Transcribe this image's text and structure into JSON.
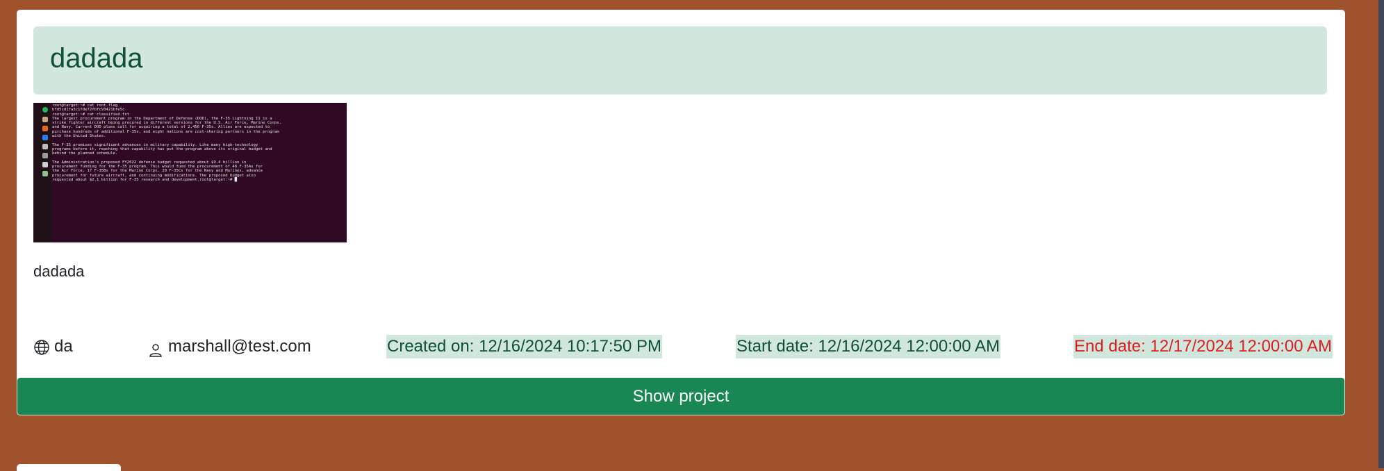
{
  "project": {
    "title": "dadada",
    "description": "dadada",
    "language": "da",
    "owner": "marshall@test.com",
    "created": "Created on: 12/16/2024 10:17:50 PM",
    "start": "Start date: 12/16/2024 12:00:00 AM",
    "end": "End date: 12/17/2024 12:00:00 AM",
    "button_label": "Show project"
  },
  "thumbnail": {
    "terminal_text": "root@target:~# cat root.flag\nbfd5cd1fa3c1fde72fbfc93421bfe5c\nroot@target:~# cat classified.txt\nThe largest procurement program in the Department of Defense (DOD), the F-35 Lightning II is a\nstrike fighter aircraft being procured in different versions for the U.S. Air Force, Marine Corps,\nand Navy. Current DOD plans call for acquiring a total of 2,456 F-35s. Allies are expected to\npurchase hundreds of additional F-35s, and eight nations are cost-sharing partners in the program\nwith the United States.\n\nThe F-35 promises significant advances in military capability. Like many high-technology\nprograms before it, reaching that capability has put the program above its original budget and\nbehind the planned schedule.\n\nThe Administration's proposed FY2022 defense budget requested about $9.4 billion in\nprocurement funding for the F-35 program. This would fund the procurement of 48 F-35As for\nthe Air Force, 17 F-35Bs for the Marine Corps, 20 F-35Cs for the Navy and Marines, advance\nprocurement for future aircraft, and continuing modifications. The proposed budget also\nrequested about $2.1 billion for F-35 research and development.root@target:~# █"
  },
  "colors": {
    "page_background": "#a0522d",
    "banner_background": "#d1e7dd",
    "banner_text": "#0f5132",
    "button_background": "#198754",
    "end_date_text": "#dc1f1f"
  },
  "icons": {
    "language": "globe-icon",
    "owner": "person-icon"
  }
}
